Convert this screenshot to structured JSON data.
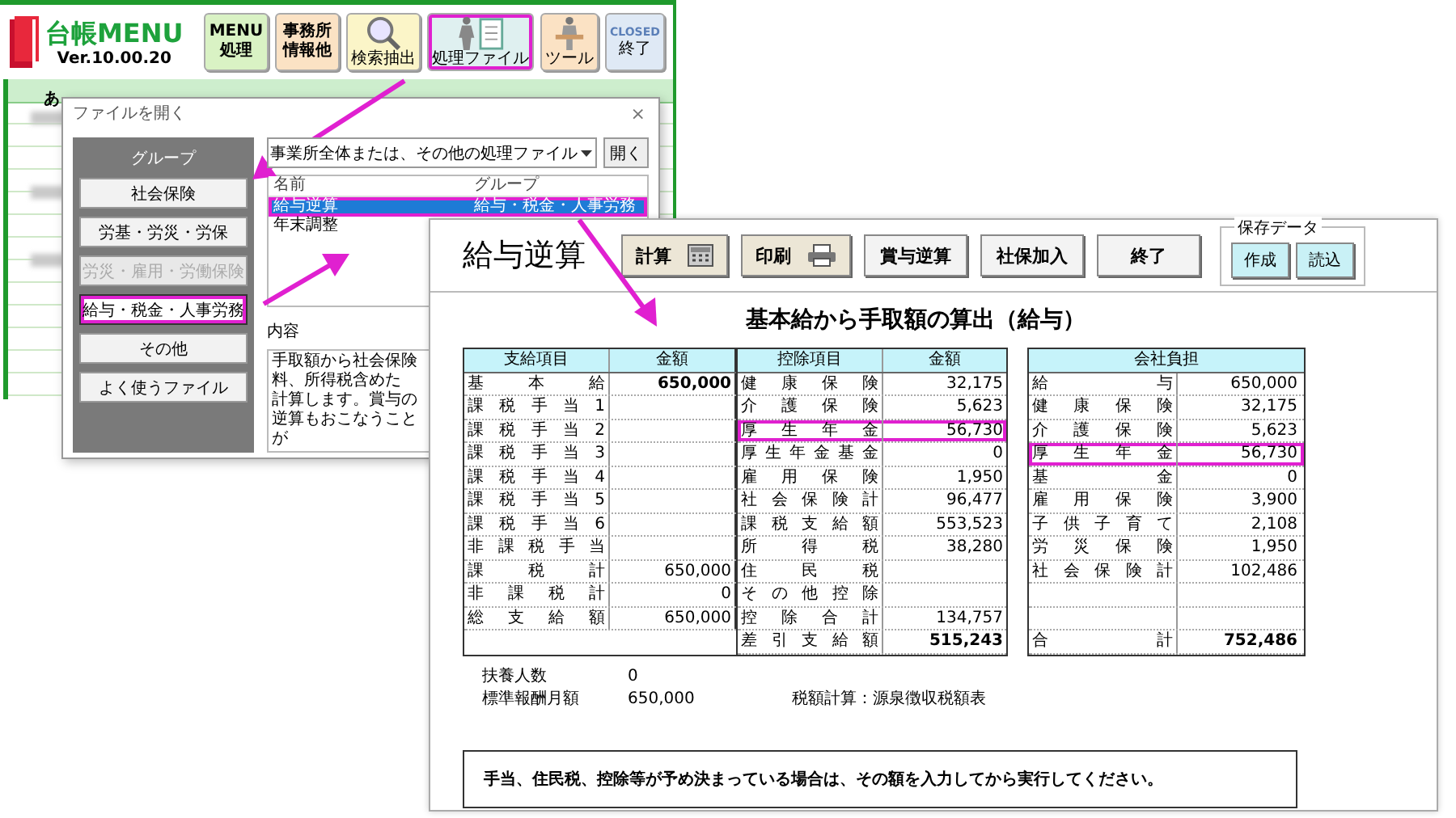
{
  "launcher": {
    "logo_title": "台帳MENU",
    "version": "Ver.10.00.20",
    "buttons": [
      {
        "kind": "text",
        "lines": [
          "MENU",
          "処理"
        ],
        "color": "#d9f2c4",
        "highlighted": false
      },
      {
        "kind": "text",
        "lines": [
          "事務所",
          "情報他"
        ],
        "color": "#fbe2c4",
        "highlighted": false
      },
      {
        "kind": "search",
        "caption": "検索抽出",
        "color": "#fbf5c8",
        "highlighted": false
      },
      {
        "kind": "files",
        "caption": "処理ファイル",
        "color": "#dff0f0",
        "highlighted": true
      },
      {
        "kind": "tool",
        "caption": "ツール",
        "color": "#fbe2c4",
        "highlighted": false
      },
      {
        "kind": "closed",
        "badge": "CLOSED",
        "caption": "終了",
        "color": "#dfe9f5",
        "highlighted": false
      }
    ],
    "sheet": {
      "column_1": "あ"
    }
  },
  "dialog": {
    "title": "ファイルを開く",
    "close": "×",
    "group_label": "グループ",
    "groups": [
      {
        "label": "社会保険",
        "selected": false,
        "disabled": false,
        "highlighted": false
      },
      {
        "label": "労基・労災・労保",
        "selected": false,
        "disabled": false,
        "highlighted": false
      },
      {
        "label": "労災・雇用・労働保険",
        "selected": false,
        "disabled": true,
        "highlighted": false
      },
      {
        "label": "給与・税金・人事労務",
        "selected": true,
        "disabled": false,
        "highlighted": true
      },
      {
        "label": "その他",
        "selected": false,
        "disabled": false,
        "highlighted": false
      },
      {
        "label": "よく使うファイル",
        "selected": false,
        "disabled": false,
        "highlighted": false
      }
    ],
    "file_type": "事業所全体または、その他の処理ファイル",
    "open_button": "開く",
    "list_columns": [
      "名前",
      "グループ"
    ],
    "files": [
      {
        "name": "給与逆算",
        "group": "給与・税金・人事労務",
        "selected": true,
        "highlighted": true
      },
      {
        "name": "年末調整",
        "selected": false,
        "highlighted": false
      }
    ],
    "description_label": "内容",
    "description_lines": [
      "手取額から社会保険料、所得税含めた",
      "計算します。賞与の逆算もおこなうことが"
    ]
  },
  "calc": {
    "title": "給与逆算",
    "buttons": [
      {
        "label": "計算",
        "kind": "calculator"
      },
      {
        "label": "印刷",
        "kind": "printer"
      },
      {
        "label": "賞与逆算",
        "kind": "plain"
      },
      {
        "label": "社保加入",
        "kind": "plain"
      },
      {
        "label": "終了",
        "kind": "plain"
      }
    ],
    "save_group": {
      "title": "保存データ",
      "buttons": [
        "作成",
        "読込"
      ]
    },
    "heading": "基本給から手取額の算出（給与）",
    "payments": {
      "columns": [
        "支給項目",
        "金額"
      ],
      "rows": [
        {
          "label": "基本給",
          "amount": "650,000",
          "bold": true
        },
        {
          "label": "課税手当1"
        },
        {
          "label": "課税手当2"
        },
        {
          "label": "課税手当3"
        },
        {
          "label": "課税手当4"
        },
        {
          "label": "課税手当5"
        },
        {
          "label": "課税手当6"
        },
        {
          "label": "非課税手当"
        },
        {
          "label": "課税計",
          "amount": "650,000"
        },
        {
          "label": "非課税計",
          "amount": "0"
        },
        {
          "label": "総支給額",
          "amount": "650,000"
        }
      ]
    },
    "deductions": {
      "columns": [
        "控除項目",
        "金額"
      ],
      "rows": [
        {
          "label": "健康保険",
          "amount": "32,175"
        },
        {
          "label": "介護保険",
          "amount": "5,623"
        },
        {
          "label": "厚生年金",
          "amount": "56,730",
          "highlighted": true
        },
        {
          "label": "厚生年金基金",
          "amount": "0"
        },
        {
          "label": "雇用保険",
          "amount": "1,950"
        },
        {
          "label": "社会保険計",
          "amount": "96,477"
        },
        {
          "label": "課税支給額",
          "amount": "553,523"
        },
        {
          "label": "所得税",
          "amount": "38,280"
        },
        {
          "label": "住民税"
        },
        {
          "label": "その他控除"
        },
        {
          "label": "控除合計",
          "amount": "134,757"
        },
        {
          "label": "差引支給額",
          "amount": "515,243",
          "bold": true
        }
      ]
    },
    "company": {
      "title": "会社負担",
      "rows": [
        {
          "kind": "item",
          "label": "給与",
          "amount": "650,000"
        },
        {
          "kind": "item",
          "label": "健康保険",
          "amount": "32,175"
        },
        {
          "kind": "item",
          "label": "介護保険",
          "amount": "5,623"
        },
        {
          "kind": "item",
          "label": "厚生年金",
          "amount": "56,730",
          "highlighted": true
        },
        {
          "kind": "item",
          "label": "基金",
          "amount": "0"
        },
        {
          "kind": "item",
          "label": "雇用保険",
          "amount": "3,900"
        },
        {
          "kind": "item",
          "label": "子供子育て",
          "amount": "2,108"
        },
        {
          "kind": "item",
          "label": "労災保険",
          "amount": "1,950"
        },
        {
          "kind": "item",
          "label": "社会保険計",
          "amount": "102,486"
        },
        {
          "kind": "blank"
        },
        {
          "kind": "blank"
        },
        {
          "kind": "item",
          "label": "合計",
          "amount": "752,486",
          "bold": true
        }
      ]
    },
    "info": [
      {
        "label": "扶養人数",
        "value": "0"
      },
      {
        "label": "標準報酬月額",
        "value": "650,000"
      }
    ],
    "tax_method": "税額計算：源泉徴収税額表",
    "notice": "手当、住民税、控除等が予め決まっている場合は、その額を入力してから実行してください。"
  }
}
